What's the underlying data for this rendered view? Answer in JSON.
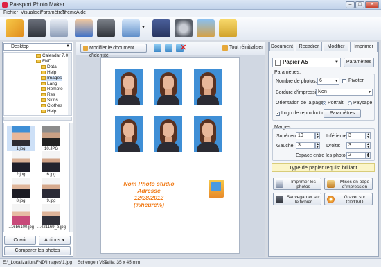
{
  "window": {
    "title": "Passport Photo Maker"
  },
  "menu": [
    "Fichier",
    "Visualiser",
    "Paramètres",
    "Thème",
    "Aide"
  ],
  "toolbar": {
    "icons": [
      "wizard-icon",
      "save-icon",
      "print-icon",
      "users-icon",
      "camera-icon",
      "monitor-icon",
      "book-icon",
      "film-icon",
      "home-icon",
      "cart-icon"
    ]
  },
  "left": {
    "folder": "Desktop",
    "tree": [
      "Calendar 7.0",
      "FND",
      "Data",
      "Help",
      "Images",
      "Lang",
      "Remote",
      "Res",
      "Skins",
      "Clothes",
      "Help"
    ],
    "thumbs": [
      "1.jpg",
      "10.JPG",
      "2.jpg",
      "6.jpg",
      "8.jpg",
      "9.jpg",
      "...16b6100.jpg",
      "...421169_b.jpg"
    ],
    "open_label": "Ouvrir",
    "actions_label": "Actions",
    "compare_label": "Comparer les photos"
  },
  "center": {
    "edit_doc_label": "Modifier le document d'identité",
    "reset_label": "Tout réinitialiser",
    "studio": {
      "line1": "Nom Photo studio",
      "line2": "Adresse",
      "line3": "12/28/2012",
      "line4": "(%heure%)"
    }
  },
  "right": {
    "tabs": [
      "Document",
      "Recadrer",
      "Modifier",
      "Imprimer"
    ],
    "paper": "Papier A5",
    "params_button": "Paramètres",
    "params_title": "Paramètres:",
    "nb_photos_label": "Nombre de photos:",
    "nb_photos_value": "6",
    "pivoter_label": "Pivoter",
    "bordure_label": "Bordure d'impression:",
    "bordure_value": "Non",
    "orientation_label": "Orientation de la page",
    "portrait_label": "Portrait",
    "paysage_label": "Paysage",
    "logo_label": "Logo de reproduction:",
    "logo_params": "Paramètres",
    "marges_title": "Marges:",
    "superieure_label": "Supérieure:",
    "superieure_value": "10",
    "inferieure_label": "Inférieure:",
    "inferieure_value": "3",
    "gauche_label": "Gauche:",
    "gauche_value": "3",
    "droite_label": "Droite:",
    "droite_value": "3",
    "espace_label": "Espace entre les photos:",
    "espace_value": "2",
    "paper_required": "Type de papier requis: brillant",
    "btn_print": "Imprimer les photos",
    "btn_layout": "Mises en page d'impression",
    "btn_save": "Sauvegarder sur le fichier",
    "btn_burn": "Graver sur CD/DVD"
  },
  "status": {
    "path": "E:\\_Localization\\FND\\Images\\1.jpg",
    "doc": "Schengen Visa",
    "size": "Taille: 35 x 45 mm"
  }
}
